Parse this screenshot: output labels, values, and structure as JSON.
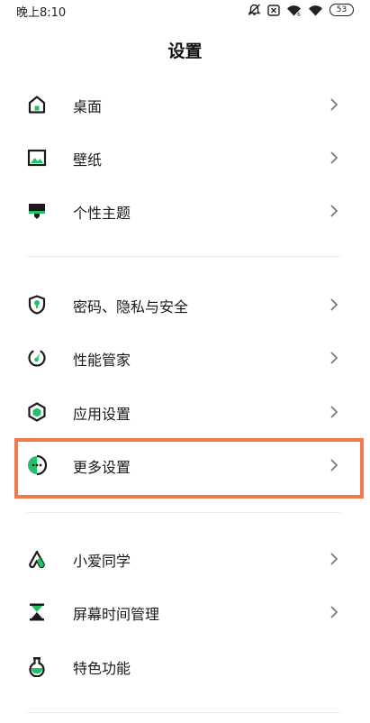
{
  "status_bar": {
    "time": "晚上8:10",
    "battery": "53",
    "icons": [
      "bell-off-icon",
      "close-box-icon",
      "wifi-6-icon",
      "wifi-icon",
      "battery-icon"
    ]
  },
  "header": {
    "title": "设置"
  },
  "sections": [
    {
      "items": [
        {
          "label": "桌面",
          "icon": "home-icon"
        },
        {
          "label": "壁纸",
          "icon": "wallpaper-icon"
        },
        {
          "label": "个性主题",
          "icon": "theme-icon"
        }
      ]
    },
    {
      "items": [
        {
          "label": "密码、隐私与安全",
          "icon": "shield-lock-icon"
        },
        {
          "label": "性能管家",
          "icon": "performance-icon"
        },
        {
          "label": "应用设置",
          "icon": "app-settings-icon"
        },
        {
          "label": "更多设置",
          "icon": "more-settings-icon",
          "highlighted": true
        }
      ]
    },
    {
      "items": [
        {
          "label": "小爱同学",
          "icon": "xiaoai-icon"
        },
        {
          "label": "屏幕时间管理",
          "icon": "hourglass-icon"
        },
        {
          "label": "特色功能",
          "icon": "flask-icon"
        }
      ]
    }
  ],
  "colors": {
    "accent": "#22c06a",
    "icon_stroke": "#1a1a1a",
    "highlight": "#ee7a4e",
    "chevron": "#7a7a7a"
  }
}
